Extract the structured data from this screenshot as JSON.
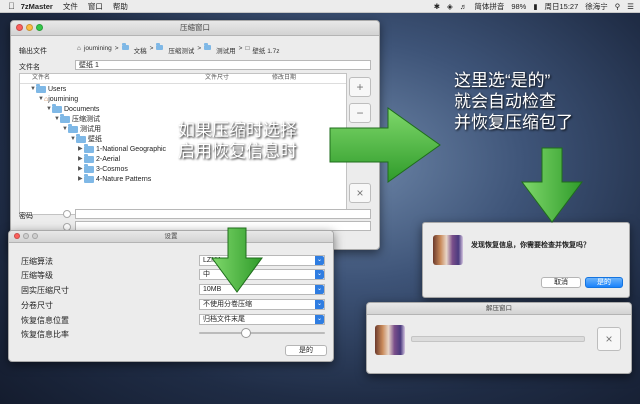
{
  "menubar": {
    "app": "7zMaster",
    "items": [
      "文件",
      "窗口",
      "帮助"
    ],
    "status": {
      "input": "简体拼音",
      "battery": "98%",
      "datetime": "周日15:27",
      "user": "徐海宁"
    }
  },
  "compress_window": {
    "title": "压缩窗口",
    "output_label": "输出文件",
    "breadcrumb": [
      "joumining",
      "文稿",
      "压缩测试",
      "测试用",
      "壁纸 1.7z"
    ],
    "filename_label": "文件名",
    "filename_value": "壁纸 1",
    "columns": {
      "name": "文件名",
      "size": "文件尺寸",
      "modified": "修改日期"
    },
    "tree": [
      {
        "label": "Users",
        "level": 0
      },
      {
        "label": "joumining",
        "level": 1
      },
      {
        "label": "Documents",
        "level": 2
      },
      {
        "label": "压缩测试",
        "level": 3
      },
      {
        "label": "测试用",
        "level": 4
      },
      {
        "label": "壁纸",
        "level": 5
      },
      {
        "label": "1-National Geographic",
        "level": 6
      },
      {
        "label": "2-Aerial",
        "level": 6
      },
      {
        "label": "3-Cosmos",
        "level": 6
      },
      {
        "label": "4-Nature Patterns",
        "level": 6
      }
    ],
    "add_btn": "+",
    "remove_btn": "−",
    "close_btn": "×",
    "password_label": "密码"
  },
  "settings_window": {
    "title": "设置",
    "rows": [
      {
        "label": "压缩算法",
        "value": "LZMA"
      },
      {
        "label": "压缩等级",
        "value": "中"
      },
      {
        "label": "固实压缩尺寸",
        "value": "10MB"
      },
      {
        "label": "分卷尺寸",
        "value": "不使用分卷压缩"
      },
      {
        "label": "恢复信息位置",
        "value": "归档文件末尾"
      },
      {
        "label": "恢复信息比率",
        "value": ""
      }
    ],
    "ok_btn": "是的"
  },
  "dialog": {
    "message": "发现恢复信息，你需要检查并恢复吗？",
    "cancel": "取消",
    "ok": "是的"
  },
  "decompress_window": {
    "title": "解压窗口",
    "close_btn": "×"
  },
  "annotations": {
    "left_line1": "如果压缩时选择",
    "left_line2": "启用恢复信息时",
    "right_line1": "这里选“是的”",
    "right_line2": "就会自动检查",
    "right_line3": "并恢复压缩包了"
  },
  "colors": {
    "arrow": "#3fb33a",
    "accent": "#1a82fb"
  }
}
